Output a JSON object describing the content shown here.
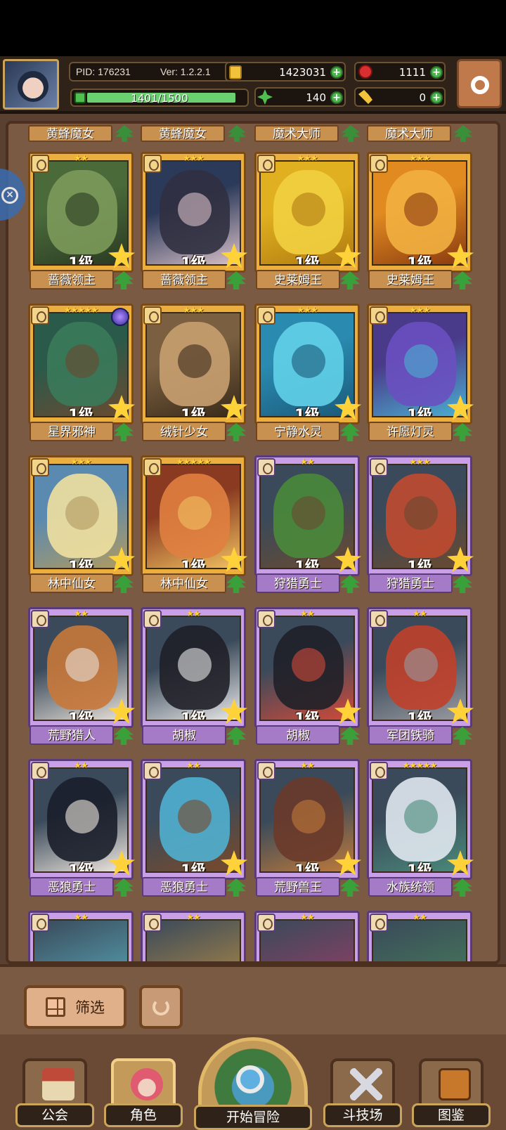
{
  "status_bar": {},
  "hud": {
    "pid": "PID: 176231",
    "version": "Ver: 1.2.2.1",
    "gold": "1423031",
    "apples": "1111",
    "xp": "1401/1500",
    "xp_fraction": 0.934,
    "clover": "140",
    "keys": "0"
  },
  "previous_row": {
    "names": [
      "黄蜂魔女",
      "黄蜂魔女",
      "魔术大师",
      "魔术大师"
    ]
  },
  "cards": [
    {
      "name": "蔷薇领主",
      "level": "1级",
      "stars": "★★",
      "frame": "gold",
      "palette": [
        "#4a6a3a",
        "#7c9a5a",
        "#2a3a22"
      ]
    },
    {
      "name": "蔷薇领主",
      "level": "1级",
      "stars": "★★★",
      "frame": "gold",
      "palette": [
        "#2c3a5a",
        "#303040",
        "#d8c0c8"
      ]
    },
    {
      "name": "史莱姆王",
      "level": "1级",
      "stars": "★★★",
      "frame": "gold",
      "palette": [
        "#e0b020",
        "#f2d040",
        "#b07a10"
      ]
    },
    {
      "name": "史莱姆王",
      "level": "1级",
      "stars": "★★★",
      "frame": "gold",
      "palette": [
        "#e08a20",
        "#f2b040",
        "#8a3a10"
      ]
    },
    {
      "name": "星界邪神",
      "level": "1级",
      "stars": "★★★★★",
      "frame": "gold",
      "palette": [
        "#2a5a4a",
        "#3a7a5a",
        "#6a4a30"
      ],
      "orb": true
    },
    {
      "name": "绒针少女",
      "level": "1级",
      "stars": "★★★",
      "frame": "gold",
      "palette": [
        "#7a6040",
        "#c8a070",
        "#3a2a1a"
      ]
    },
    {
      "name": "宁静水灵",
      "level": "1级",
      "stars": "★★★",
      "frame": "gold",
      "palette": [
        "#2a8ab0",
        "#60d0e8",
        "#1a5a7a"
      ]
    },
    {
      "name": "许愿灯灵",
      "level": "1级",
      "stars": "★★★",
      "frame": "gold",
      "palette": [
        "#4a3a8a",
        "#6a50c0",
        "#4ab0d0"
      ]
    },
    {
      "name": "林中仙女",
      "level": "1级",
      "stars": "★★★",
      "frame": "gold",
      "palette": [
        "#5a8ab0",
        "#f0e0a0",
        "#b09a60"
      ]
    },
    {
      "name": "林中仙女",
      "level": "1级",
      "stars": "★★★★★",
      "frame": "gold",
      "palette": [
        "#8a3a20",
        "#e08040",
        "#f0c060"
      ]
    },
    {
      "name": "狩猎勇士",
      "level": "1级",
      "stars": "★★",
      "frame": "purple",
      "palette": [
        "#3a4a5a",
        "#4a8a3a",
        "#6a4a30"
      ]
    },
    {
      "name": "狩猎勇士",
      "level": "1级",
      "stars": "★★★",
      "frame": "purple",
      "palette": [
        "#3a4a5a",
        "#c04a30",
        "#6a4a30"
      ]
    },
    {
      "name": "荒野猎人",
      "level": "1级",
      "stars": "★★",
      "frame": "purple",
      "palette": [
        "#3a4a5a",
        "#c8783a",
        "#e8e0d8"
      ]
    },
    {
      "name": "胡椒",
      "level": "1级",
      "stars": "★★",
      "frame": "purple",
      "palette": [
        "#3a4a5a",
        "#202028",
        "#e8e8e8"
      ]
    },
    {
      "name": "胡椒",
      "level": "1级",
      "stars": "★★",
      "frame": "purple",
      "palette": [
        "#3a4a5a",
        "#202028",
        "#d04a3a"
      ]
    },
    {
      "name": "军团铁骑",
      "level": "1级",
      "stars": "★★",
      "frame": "purple",
      "palette": [
        "#3a4a5a",
        "#c0402a",
        "#9a9aa0"
      ]
    },
    {
      "name": "恶狼勇士",
      "level": "1级",
      "stars": "★★",
      "frame": "purple",
      "palette": [
        "#3a4a5a",
        "#1a1e2a",
        "#f0e8e0"
      ]
    },
    {
      "name": "恶狼勇士",
      "level": "1级",
      "stars": "★★",
      "frame": "purple",
      "palette": [
        "#3a4a5a",
        "#50b0d0",
        "#7a4a2a"
      ]
    },
    {
      "name": "荒野兽王",
      "level": "1级",
      "stars": "★★",
      "frame": "purple",
      "palette": [
        "#3a4a5a",
        "#6a3a2a",
        "#c07a3a"
      ]
    },
    {
      "name": "水族统领",
      "level": "1级",
      "stars": "★★★★★",
      "frame": "purple",
      "palette": [
        "#3a4a5a",
        "#e0e8f0",
        "#4a8a7a"
      ]
    }
  ],
  "partial_row": {
    "stars": [
      "★★",
      "★★",
      "★★",
      "★★"
    ],
    "palette": [
      "#60c0d0",
      "#d09a40",
      "#b03a6a",
      "#4a8a5a"
    ]
  },
  "filter": {
    "filter_label": "筛选"
  },
  "nav": {
    "guild": "公会",
    "character": "角色",
    "adventure": "开始冒险",
    "arena": "斗技场",
    "codex": "图鉴"
  }
}
